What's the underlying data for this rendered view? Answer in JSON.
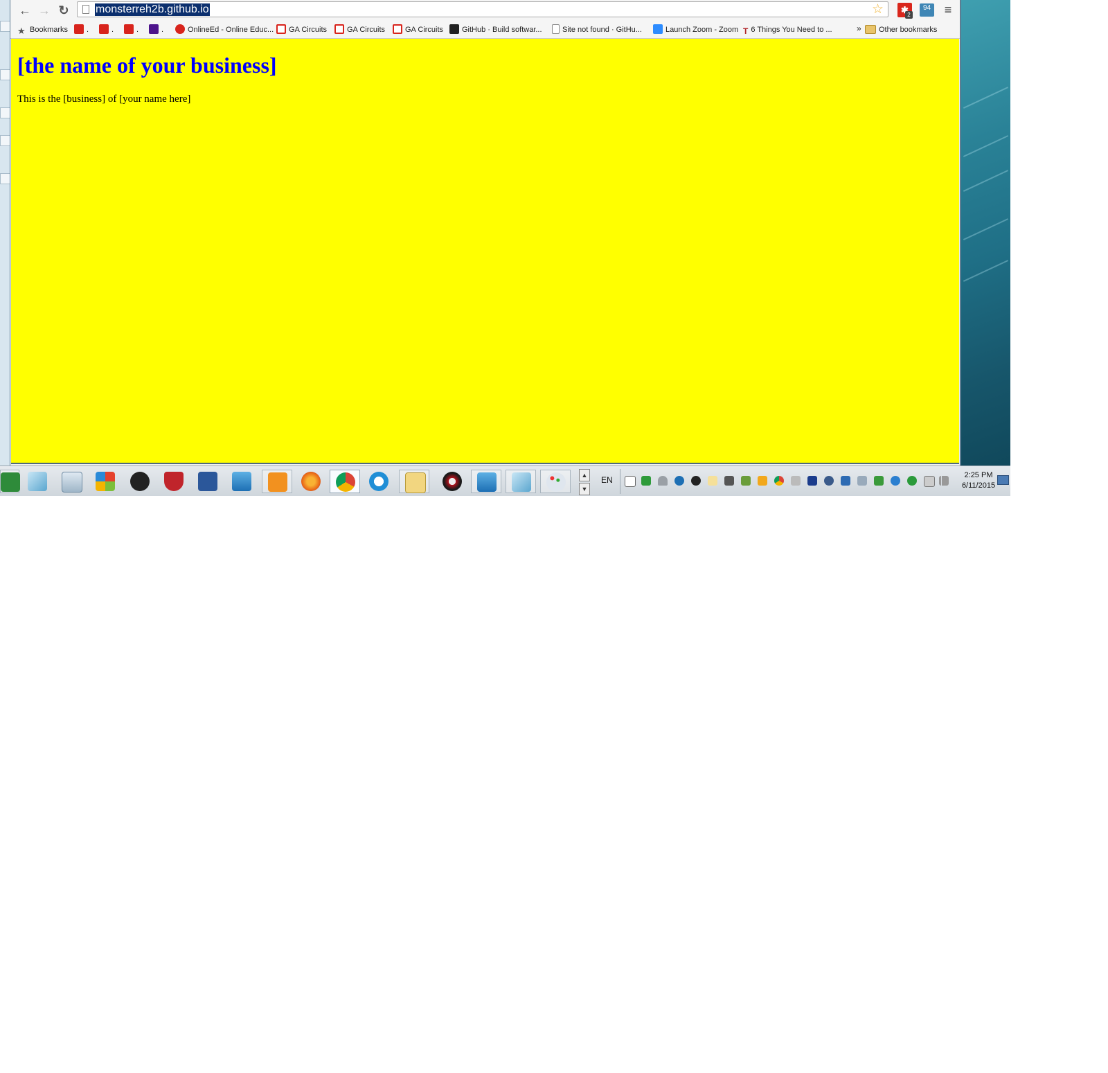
{
  "browser": {
    "url": "monsterreh2b.github.io",
    "back_icon": "arrow-left-icon",
    "forward_icon": "arrow-right-icon",
    "reload_icon": "reload-icon",
    "bookmark_star_icon": "star-icon",
    "extension_badge": "2",
    "extension2_label": "94",
    "menu_icon": "hamburger-icon"
  },
  "bookmarks_bar": {
    "items": [
      {
        "label": "Bookmarks",
        "icon": "star-icon"
      },
      {
        "label": ".",
        "icon": "red-logo-icon"
      },
      {
        "label": ".",
        "icon": "red-logo-icon"
      },
      {
        "label": ".",
        "icon": "red-chat-icon"
      },
      {
        "label": ".",
        "icon": "fedex-icon"
      },
      {
        "label": "OnlineEd - Online Educ...",
        "icon": "onlineed-icon"
      },
      {
        "label": "GA Circuits",
        "icon": "ga-icon"
      },
      {
        "label": "GA Circuits",
        "icon": "ga-icon"
      },
      {
        "label": "GA Circuits",
        "icon": "ga-icon"
      },
      {
        "label": "GitHub · Build softwar...",
        "icon": "github-icon"
      },
      {
        "label": "Site not found · GitHu...",
        "icon": "document-icon"
      },
      {
        "label": "Launch Zoom - Zoom",
        "icon": "zoom-icon"
      },
      {
        "label": "6 Things You Need to ...",
        "icon": "t-logo-icon"
      }
    ],
    "overflow": "»",
    "other_bookmarks": "Other bookmarks"
  },
  "page": {
    "heading": "[the name of your business]",
    "paragraph": "This is the [business] of [your name here]",
    "background_color": "#ffff00",
    "heading_color": "#0000ff"
  },
  "taskbar": {
    "apps": [
      "excel-icon",
      "notepad-icon",
      "calculator-icon",
      "windows-flag-icon",
      "pencil-app-icon",
      "mcafee-icon",
      "word-icon",
      "mail-icon",
      "ecc-icon",
      "firefox-icon",
      "chrome-icon",
      "c-app-icon",
      "file-explorer-icon",
      "camera-app-icon",
      "mail-icon",
      "notepad-icon",
      "paint-icon"
    ],
    "language": "EN",
    "time": "2:25 PM",
    "date": "6/11/2015"
  }
}
